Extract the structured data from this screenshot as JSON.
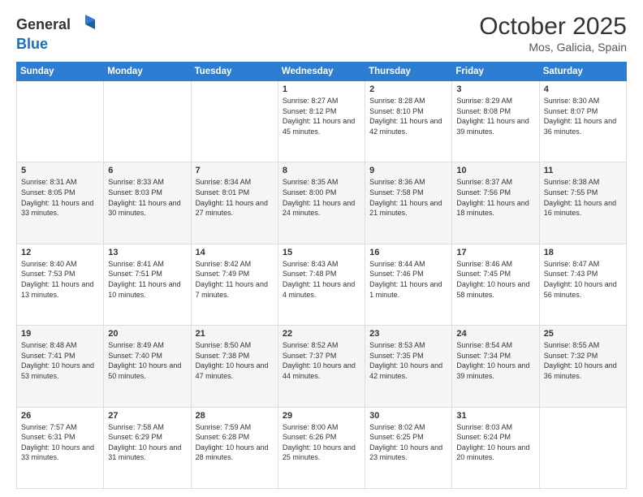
{
  "logo": {
    "general": "General",
    "blue": "Blue"
  },
  "title": "October 2025",
  "subtitle": "Mos, Galicia, Spain",
  "days_of_week": [
    "Sunday",
    "Monday",
    "Tuesday",
    "Wednesday",
    "Thursday",
    "Friday",
    "Saturday"
  ],
  "weeks": [
    [
      {
        "day": "",
        "sunrise": "",
        "sunset": "",
        "daylight": ""
      },
      {
        "day": "",
        "sunrise": "",
        "sunset": "",
        "daylight": ""
      },
      {
        "day": "",
        "sunrise": "",
        "sunset": "",
        "daylight": ""
      },
      {
        "day": "1",
        "sunrise": "Sunrise: 8:27 AM",
        "sunset": "Sunset: 8:12 PM",
        "daylight": "Daylight: 11 hours and 45 minutes."
      },
      {
        "day": "2",
        "sunrise": "Sunrise: 8:28 AM",
        "sunset": "Sunset: 8:10 PM",
        "daylight": "Daylight: 11 hours and 42 minutes."
      },
      {
        "day": "3",
        "sunrise": "Sunrise: 8:29 AM",
        "sunset": "Sunset: 8:08 PM",
        "daylight": "Daylight: 11 hours and 39 minutes."
      },
      {
        "day": "4",
        "sunrise": "Sunrise: 8:30 AM",
        "sunset": "Sunset: 8:07 PM",
        "daylight": "Daylight: 11 hours and 36 minutes."
      }
    ],
    [
      {
        "day": "5",
        "sunrise": "Sunrise: 8:31 AM",
        "sunset": "Sunset: 8:05 PM",
        "daylight": "Daylight: 11 hours and 33 minutes."
      },
      {
        "day": "6",
        "sunrise": "Sunrise: 8:33 AM",
        "sunset": "Sunset: 8:03 PM",
        "daylight": "Daylight: 11 hours and 30 minutes."
      },
      {
        "day": "7",
        "sunrise": "Sunrise: 8:34 AM",
        "sunset": "Sunset: 8:01 PM",
        "daylight": "Daylight: 11 hours and 27 minutes."
      },
      {
        "day": "8",
        "sunrise": "Sunrise: 8:35 AM",
        "sunset": "Sunset: 8:00 PM",
        "daylight": "Daylight: 11 hours and 24 minutes."
      },
      {
        "day": "9",
        "sunrise": "Sunrise: 8:36 AM",
        "sunset": "Sunset: 7:58 PM",
        "daylight": "Daylight: 11 hours and 21 minutes."
      },
      {
        "day": "10",
        "sunrise": "Sunrise: 8:37 AM",
        "sunset": "Sunset: 7:56 PM",
        "daylight": "Daylight: 11 hours and 18 minutes."
      },
      {
        "day": "11",
        "sunrise": "Sunrise: 8:38 AM",
        "sunset": "Sunset: 7:55 PM",
        "daylight": "Daylight: 11 hours and 16 minutes."
      }
    ],
    [
      {
        "day": "12",
        "sunrise": "Sunrise: 8:40 AM",
        "sunset": "Sunset: 7:53 PM",
        "daylight": "Daylight: 11 hours and 13 minutes."
      },
      {
        "day": "13",
        "sunrise": "Sunrise: 8:41 AM",
        "sunset": "Sunset: 7:51 PM",
        "daylight": "Daylight: 11 hours and 10 minutes."
      },
      {
        "day": "14",
        "sunrise": "Sunrise: 8:42 AM",
        "sunset": "Sunset: 7:49 PM",
        "daylight": "Daylight: 11 hours and 7 minutes."
      },
      {
        "day": "15",
        "sunrise": "Sunrise: 8:43 AM",
        "sunset": "Sunset: 7:48 PM",
        "daylight": "Daylight: 11 hours and 4 minutes."
      },
      {
        "day": "16",
        "sunrise": "Sunrise: 8:44 AM",
        "sunset": "Sunset: 7:46 PM",
        "daylight": "Daylight: 11 hours and 1 minute."
      },
      {
        "day": "17",
        "sunrise": "Sunrise: 8:46 AM",
        "sunset": "Sunset: 7:45 PM",
        "daylight": "Daylight: 10 hours and 58 minutes."
      },
      {
        "day": "18",
        "sunrise": "Sunrise: 8:47 AM",
        "sunset": "Sunset: 7:43 PM",
        "daylight": "Daylight: 10 hours and 56 minutes."
      }
    ],
    [
      {
        "day": "19",
        "sunrise": "Sunrise: 8:48 AM",
        "sunset": "Sunset: 7:41 PM",
        "daylight": "Daylight: 10 hours and 53 minutes."
      },
      {
        "day": "20",
        "sunrise": "Sunrise: 8:49 AM",
        "sunset": "Sunset: 7:40 PM",
        "daylight": "Daylight: 10 hours and 50 minutes."
      },
      {
        "day": "21",
        "sunrise": "Sunrise: 8:50 AM",
        "sunset": "Sunset: 7:38 PM",
        "daylight": "Daylight: 10 hours and 47 minutes."
      },
      {
        "day": "22",
        "sunrise": "Sunrise: 8:52 AM",
        "sunset": "Sunset: 7:37 PM",
        "daylight": "Daylight: 10 hours and 44 minutes."
      },
      {
        "day": "23",
        "sunrise": "Sunrise: 8:53 AM",
        "sunset": "Sunset: 7:35 PM",
        "daylight": "Daylight: 10 hours and 42 minutes."
      },
      {
        "day": "24",
        "sunrise": "Sunrise: 8:54 AM",
        "sunset": "Sunset: 7:34 PM",
        "daylight": "Daylight: 10 hours and 39 minutes."
      },
      {
        "day": "25",
        "sunrise": "Sunrise: 8:55 AM",
        "sunset": "Sunset: 7:32 PM",
        "daylight": "Daylight: 10 hours and 36 minutes."
      }
    ],
    [
      {
        "day": "26",
        "sunrise": "Sunrise: 7:57 AM",
        "sunset": "Sunset: 6:31 PM",
        "daylight": "Daylight: 10 hours and 33 minutes."
      },
      {
        "day": "27",
        "sunrise": "Sunrise: 7:58 AM",
        "sunset": "Sunset: 6:29 PM",
        "daylight": "Daylight: 10 hours and 31 minutes."
      },
      {
        "day": "28",
        "sunrise": "Sunrise: 7:59 AM",
        "sunset": "Sunset: 6:28 PM",
        "daylight": "Daylight: 10 hours and 28 minutes."
      },
      {
        "day": "29",
        "sunrise": "Sunrise: 8:00 AM",
        "sunset": "Sunset: 6:26 PM",
        "daylight": "Daylight: 10 hours and 25 minutes."
      },
      {
        "day": "30",
        "sunrise": "Sunrise: 8:02 AM",
        "sunset": "Sunset: 6:25 PM",
        "daylight": "Daylight: 10 hours and 23 minutes."
      },
      {
        "day": "31",
        "sunrise": "Sunrise: 8:03 AM",
        "sunset": "Sunset: 6:24 PM",
        "daylight": "Daylight: 10 hours and 20 minutes."
      },
      {
        "day": "",
        "sunrise": "",
        "sunset": "",
        "daylight": ""
      }
    ]
  ]
}
